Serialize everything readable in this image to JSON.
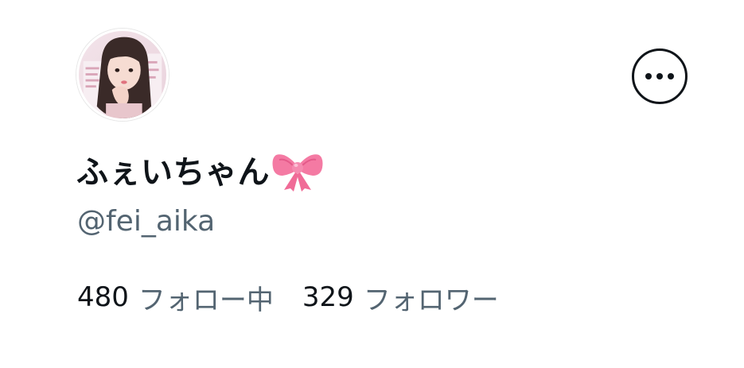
{
  "profile": {
    "display_name": "ふぇいちゃん",
    "name_emoji": "ribbon-bow-icon",
    "handle": "@fei_aika",
    "avatar": "profile-photo"
  },
  "actions": {
    "more_icon": "more-horizontal-icon"
  },
  "stats": {
    "following_count": "480",
    "following_label": "フォロー中",
    "followers_count": "329",
    "followers_label": "フォロワー"
  },
  "colors": {
    "primary_text": "#0f1419",
    "secondary_text": "#536471",
    "bow_pink": "#f47aa3",
    "background": "#ffffff"
  }
}
